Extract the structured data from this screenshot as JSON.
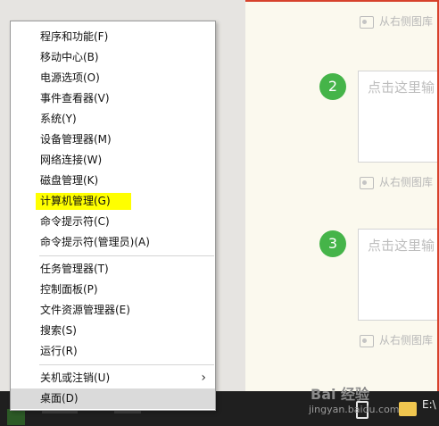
{
  "menu": {
    "items": [
      {
        "label": "程序和功能(F)"
      },
      {
        "label": "移动中心(B)"
      },
      {
        "label": "电源选项(O)"
      },
      {
        "label": "事件查看器(V)"
      },
      {
        "label": "系统(Y)"
      },
      {
        "label": "设备管理器(M)"
      },
      {
        "label": "网络连接(W)"
      },
      {
        "label": "磁盘管理(K)"
      },
      {
        "label": "计算机管理(G)"
      },
      {
        "label": "命令提示符(C)"
      },
      {
        "label": "命令提示符(管理员)(A)"
      },
      {
        "label": "任务管理器(T)"
      },
      {
        "label": "控制面板(P)"
      },
      {
        "label": "文件资源管理器(E)"
      },
      {
        "label": "搜索(S)"
      },
      {
        "label": "运行(R)"
      },
      {
        "label": "关机或注销(U)"
      },
      {
        "label": "桌面(D)"
      }
    ],
    "highlight_color": "#ffff00"
  },
  "editor": {
    "steps": [
      {
        "number": "2",
        "placeholder": "点击这里输"
      },
      {
        "number": "3",
        "placeholder": "点击这里输"
      }
    ],
    "image_hint": "从右侧图库",
    "step_color": "#45b449"
  },
  "taskbar": {
    "drive_label": "E:\\",
    "watermark": "Bai 经验",
    "watermark_sub": "jingyan.baidu.com"
  }
}
